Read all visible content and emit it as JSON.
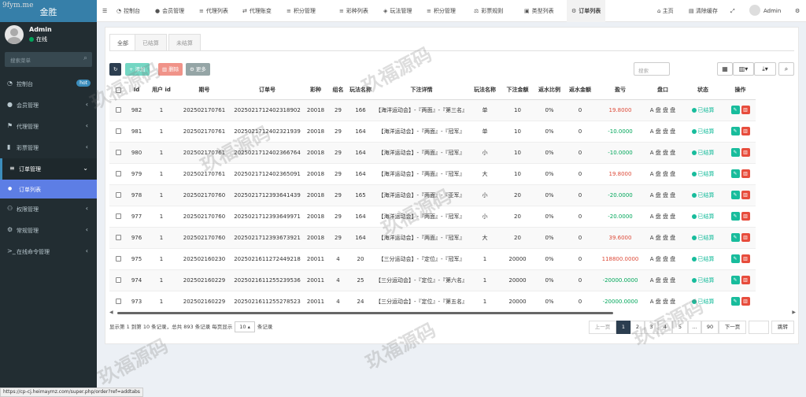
{
  "site_watermark": "9fym.me",
  "brand": "金胜",
  "user": {
    "name": "Admin",
    "status": "在线"
  },
  "search_placeholder": "搜索菜单",
  "menu": [
    {
      "label": "控制台",
      "icon": "dashboard-icon",
      "badge": "hot"
    },
    {
      "label": "会员管理",
      "icon": "user-icon"
    },
    {
      "label": "代理管理",
      "icon": "agent-icon"
    },
    {
      "label": "彩票管理",
      "icon": "lottery-icon"
    },
    {
      "label": "订单管理",
      "icon": "list-icon",
      "active": true
    },
    {
      "label": "订单列表",
      "icon": "circle-icon",
      "sub": true
    },
    {
      "label": "权限管理",
      "icon": "users-icon"
    },
    {
      "label": "常规管理",
      "icon": "cogs-icon"
    },
    {
      "label": "在线命令管理",
      "icon": "terminal-icon"
    }
  ],
  "topnav": [
    {
      "label": "控制台",
      "icon": "dashboard-icon"
    },
    {
      "label": "会员管理",
      "icon": "user-icon"
    },
    {
      "label": "代理列表",
      "icon": "list-icon"
    },
    {
      "label": "代理账变",
      "icon": "exchange-icon"
    },
    {
      "label": "积分管理",
      "icon": "list-icon"
    },
    {
      "label": "彩种列表",
      "icon": "list-icon"
    },
    {
      "label": "玩法管理",
      "icon": "gamepad-icon"
    },
    {
      "label": "积分管理",
      "icon": "list-icon"
    },
    {
      "label": "彩票规则",
      "icon": "balance-icon"
    },
    {
      "label": "类型列表",
      "icon": "folder-icon"
    },
    {
      "label": "订单列表",
      "icon": "gear-icon",
      "active": true
    }
  ],
  "topright": {
    "home": "主页",
    "clear": "清除缓存",
    "user": "Admin"
  },
  "tabs": [
    "全部",
    "已结算",
    "未结算"
  ],
  "toolbar": {
    "add": "添加",
    "delete": "删除",
    "more": "更多",
    "search_placeholder": "搜索"
  },
  "columns": [
    "Id",
    "用户 id",
    "期号",
    "订单号",
    "彩种",
    "组名",
    "玩法名称",
    "下注详情",
    "玩法名称",
    "下注金额",
    "返水比例",
    "返水金额",
    "盈亏",
    "盘口",
    "状态",
    "操作"
  ],
  "rows": [
    [
      "982",
      "1",
      "202502170761",
      "2025021712402318902",
      "20018",
      "29",
      "166",
      "【海洋运动会】-『两面』-『第三名』",
      "单",
      "10",
      "0%",
      "0",
      "19.8000",
      "A 盘 盘 盘",
      "已结算"
    ],
    [
      "981",
      "1",
      "202502170761",
      "2025021712402321939",
      "20018",
      "29",
      "164",
      "【海洋运动会】-『两面』-『冠军』",
      "单",
      "10",
      "0%",
      "0",
      "-10.0000",
      "A 盘 盘 盘",
      "已结算"
    ],
    [
      "980",
      "1",
      "202502170761",
      "2025021712402366764",
      "20018",
      "29",
      "164",
      "【海洋运动会】-『两面』-『冠军』",
      "小",
      "10",
      "0%",
      "0",
      "-10.0000",
      "A 盘 盘 盘",
      "已结算"
    ],
    [
      "979",
      "1",
      "202502170761",
      "2025021712402365091",
      "20018",
      "29",
      "164",
      "【海洋运动会】-『两面』-『冠军』",
      "大",
      "10",
      "0%",
      "0",
      "19.8000",
      "A 盘 盘 盘",
      "已结算"
    ],
    [
      "978",
      "1",
      "202502170760",
      "2025021712393641439",
      "20018",
      "29",
      "165",
      "【海洋运动会】-『两面』-『亚军』",
      "小",
      "20",
      "0%",
      "0",
      "-20.0000",
      "A 盘 盘 盘",
      "已结算"
    ],
    [
      "977",
      "1",
      "202502170760",
      "2025021712393649971",
      "20018",
      "29",
      "164",
      "【海洋运动会】-『两面』-『冠军』",
      "小",
      "20",
      "0%",
      "0",
      "-20.0000",
      "A 盘 盘 盘",
      "已结算"
    ],
    [
      "976",
      "1",
      "202502170760",
      "2025021712393673921",
      "20018",
      "29",
      "164",
      "【海洋运动会】-『两面』-『冠军』",
      "大",
      "20",
      "0%",
      "0",
      "39.6000",
      "A 盘 盘 盘",
      "已结算"
    ],
    [
      "975",
      "1",
      "202502160230",
      "2025021611272449218",
      "20011",
      "4",
      "20",
      "【三分运动会】-『定位』-『冠军』",
      "1",
      "20000",
      "0%",
      "0",
      "118800.0000",
      "A 盘 盘 盘",
      "已结算"
    ],
    [
      "974",
      "1",
      "202502160229",
      "2025021611255239536",
      "20011",
      "4",
      "25",
      "【三分运动会】-『定位』-『第六名』",
      "1",
      "20000",
      "0%",
      "0",
      "-20000.0000",
      "A 盘 盘 盘",
      "已结算"
    ],
    [
      "973",
      "1",
      "202502160229",
      "2025021611255278523",
      "20011",
      "4",
      "24",
      "【三分运动会】-『定位』-『第五名』",
      "1",
      "20000",
      "0%",
      "0",
      "-20000.0000",
      "A 盘 盘 盘",
      "已结算"
    ]
  ],
  "footer": {
    "text": "显示第 1 到第 10 条记录，总共 893 条记录 每页显示",
    "per_page": "10",
    "suffix": "条记录"
  },
  "pagination": [
    "上一页",
    "1",
    "2",
    "3",
    "4",
    "5",
    "...",
    "90",
    "下一页"
  ],
  "jump": "跳转",
  "watermark": "玖福源码",
  "status_url": "https://cp-cj.heimaymz.com/super.php/order?ref=addtabs"
}
